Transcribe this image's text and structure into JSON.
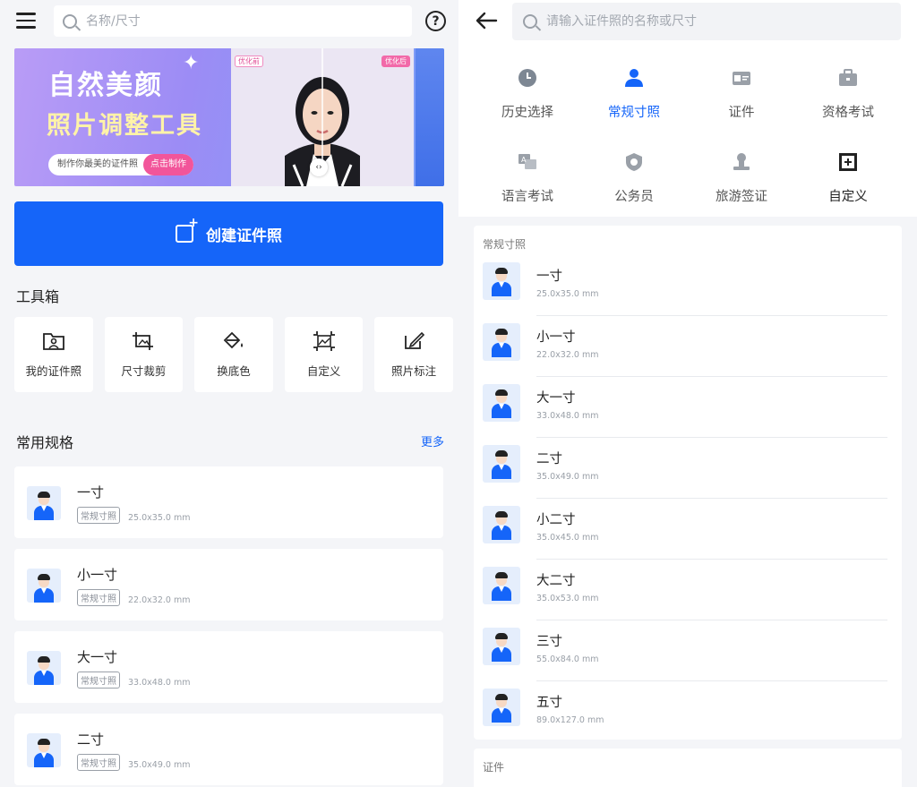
{
  "left": {
    "search": {
      "placeholder": "名称/尺寸"
    },
    "banner": {
      "title1": "自然美颜",
      "title2": "照片调整工具",
      "pill_text": "制作你最美的证件照",
      "cta": "点击制作",
      "tag_before": "优化前",
      "tag_after": "优化后"
    },
    "create_button": "创建证件照",
    "toolbox": {
      "title": "工具箱",
      "items": [
        {
          "label": "我的证件照",
          "icon": "folder-photo-icon"
        },
        {
          "label": "尺寸裁剪",
          "icon": "crop-icon"
        },
        {
          "label": "换底色",
          "icon": "paint-bucket-icon"
        },
        {
          "label": "自定义",
          "icon": "custom-frame-icon"
        },
        {
          "label": "照片标注",
          "icon": "edit-icon"
        }
      ]
    },
    "common": {
      "title": "常用规格",
      "more": "更多",
      "items": [
        {
          "name": "一寸",
          "tag": "常规寸照",
          "size": "25.0x35.0 mm"
        },
        {
          "name": "小一寸",
          "tag": "常规寸照",
          "size": "22.0x32.0 mm"
        },
        {
          "name": "大一寸",
          "tag": "常规寸照",
          "size": "33.0x48.0 mm"
        },
        {
          "name": "二寸",
          "tag": "常规寸照",
          "size": "35.0x49.0 mm"
        }
      ]
    }
  },
  "right": {
    "search": {
      "placeholder": "请输入证件照的名称或尺寸"
    },
    "categories": [
      {
        "label": "历史选择",
        "icon": "clock-icon"
      },
      {
        "label": "常规寸照",
        "icon": "person-icon",
        "active": true
      },
      {
        "label": "证件",
        "icon": "id-card-icon"
      },
      {
        "label": "资格考试",
        "icon": "briefcase-icon"
      },
      {
        "label": "语言考试",
        "icon": "language-icon"
      },
      {
        "label": "公务员",
        "icon": "badge-icon"
      },
      {
        "label": "旅游签证",
        "icon": "stamp-icon"
      },
      {
        "label": "自定义",
        "icon": "custom-frame-icon"
      }
    ],
    "section1": {
      "title": "常规寸照",
      "items": [
        {
          "name": "一寸",
          "size": "25.0x35.0 mm"
        },
        {
          "name": "小一寸",
          "size": "22.0x32.0 mm"
        },
        {
          "name": "大一寸",
          "size": "33.0x48.0 mm"
        },
        {
          "name": "二寸",
          "size": "35.0x49.0 mm"
        },
        {
          "name": "小二寸",
          "size": "35.0x45.0 mm"
        },
        {
          "name": "大二寸",
          "size": "35.0x53.0 mm"
        },
        {
          "name": "三寸",
          "size": "55.0x84.0 mm"
        },
        {
          "name": "五寸",
          "size": "89.0x127.0 mm"
        }
      ]
    },
    "section2": {
      "title": "证件"
    }
  },
  "colors": {
    "accent": "#1565f9",
    "background": "#f4f5f8",
    "pink": "#f2559a"
  }
}
